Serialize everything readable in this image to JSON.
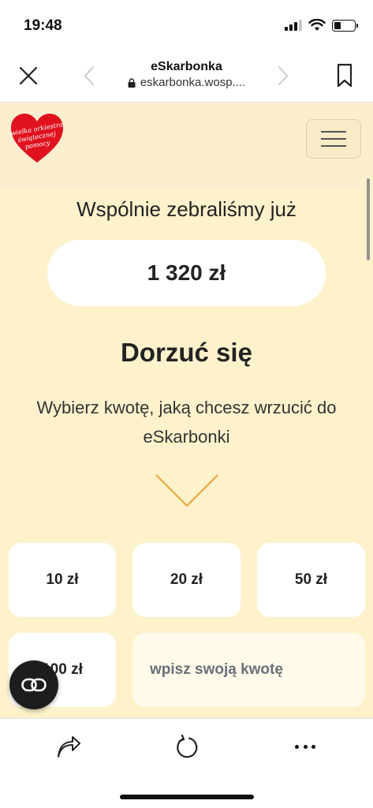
{
  "status_bar": {
    "time": "19:48"
  },
  "browser": {
    "title": "eSkarbonka",
    "url": "eskarbonka.wosp...."
  },
  "logo": {
    "text_line1": "wielka orkiestra",
    "text_line2": "świątecznej",
    "text_line3": "pomocy",
    "color": "#e0121f"
  },
  "main": {
    "collected_label": "Wspólnie zebraliśmy już",
    "collected_amount": "1 320 zł",
    "section_title": "Dorzuć się",
    "section_description": "Wybierz kwotę, jaką chcesz wrzucić do eSkarbonki",
    "amount_options": [
      "10 zł",
      "20 zł",
      "50 zł",
      "100 zł"
    ],
    "custom_amount_placeholder": "wpisz swoją kwotę"
  },
  "colors": {
    "accent_chevron": "#e8a93a",
    "page_background": "#fef2cc"
  }
}
